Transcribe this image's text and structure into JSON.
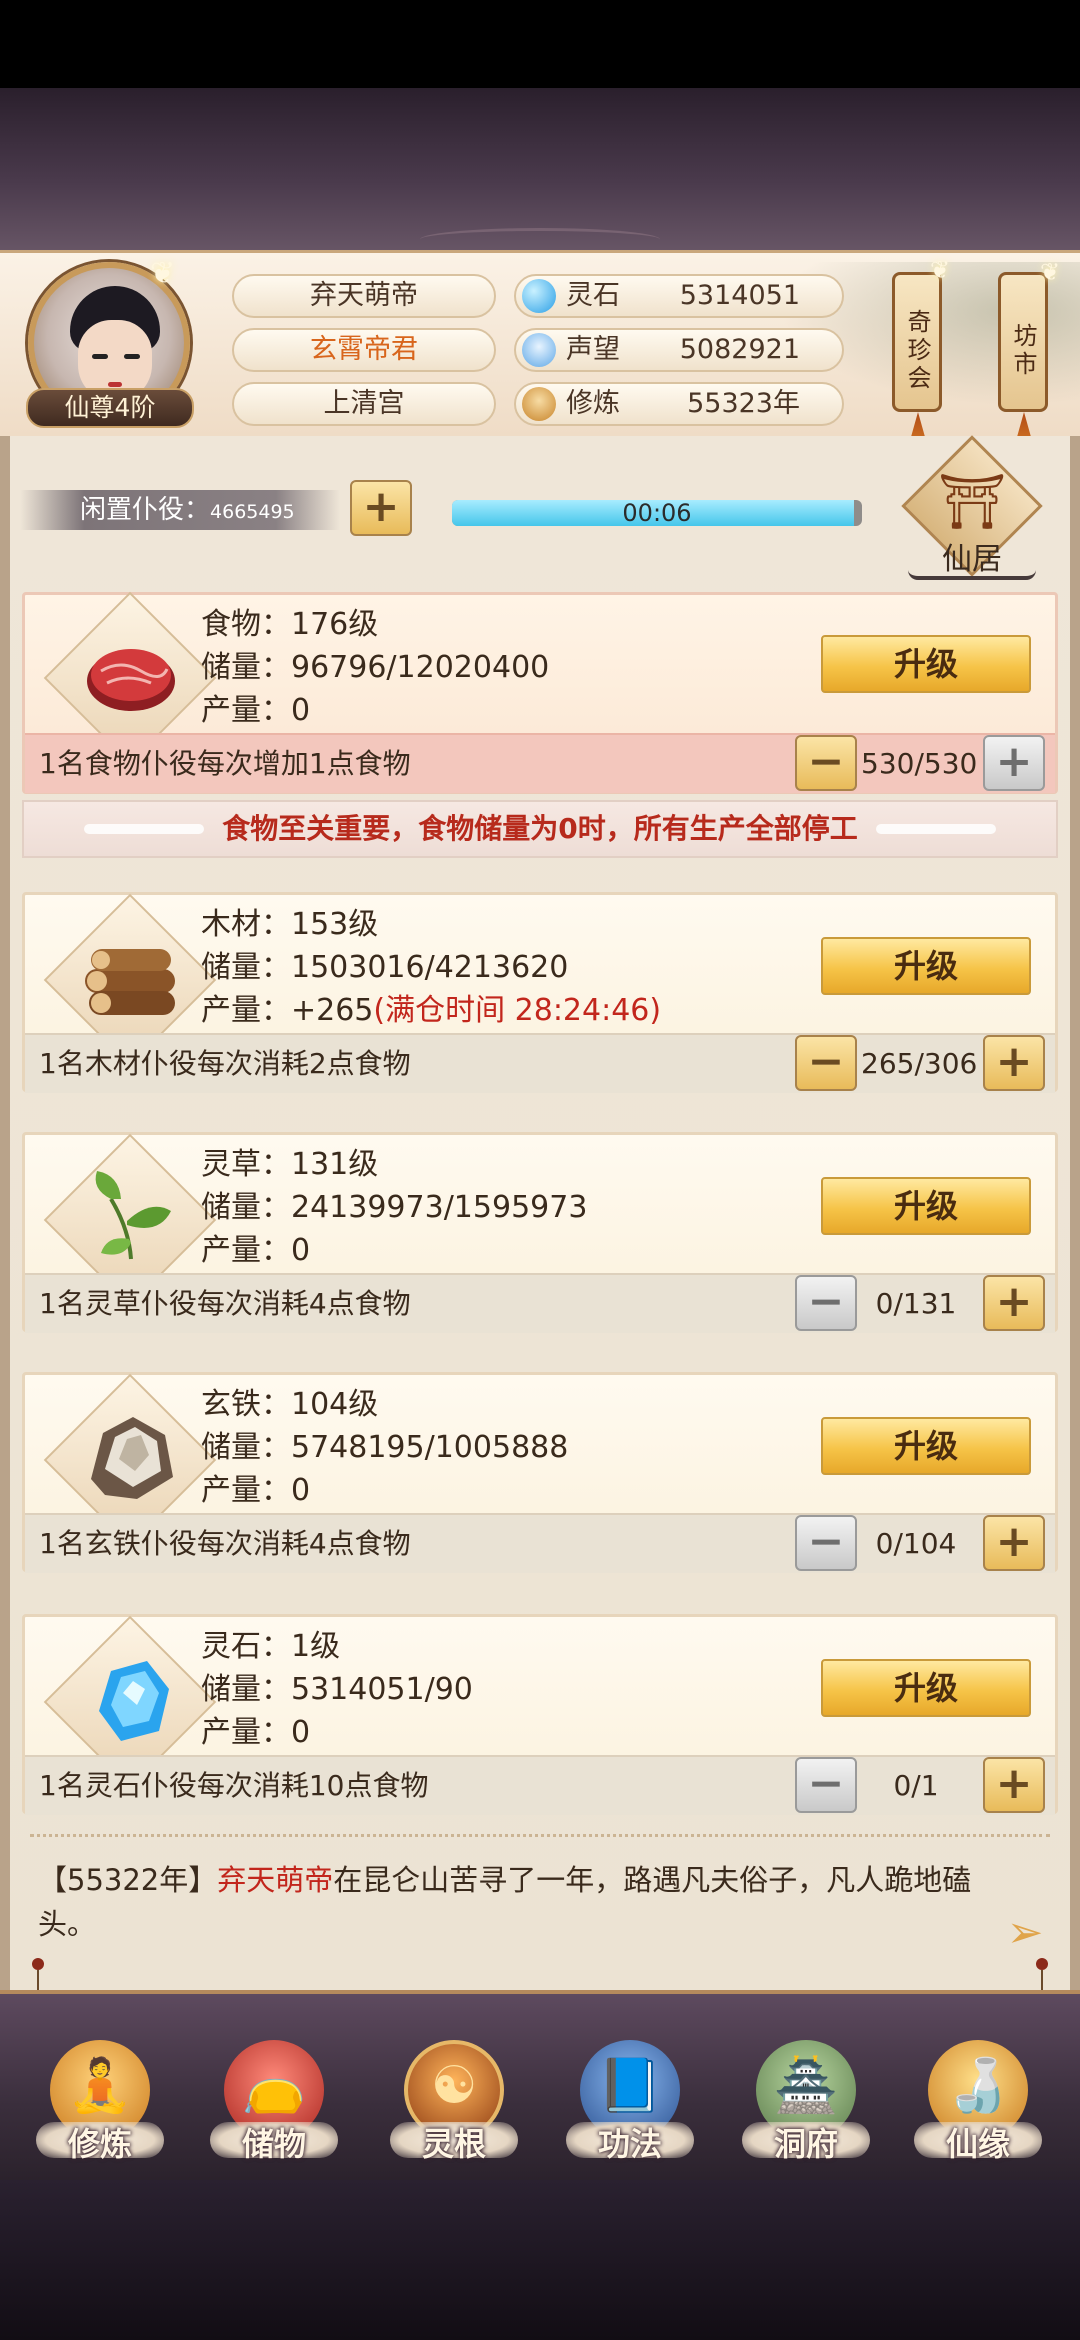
{
  "header": {
    "rank": "仙尊4阶",
    "names": [
      "弃天萌帝",
      "玄霄帝君",
      "上清宫"
    ],
    "resources": [
      {
        "icon": "spirit-stone-icon",
        "label": "灵石",
        "value": "5314051",
        "color": "#3fb6ef"
      },
      {
        "icon": "reputation-icon",
        "label": "声望",
        "value": "5082921",
        "color": "#5fa8e6"
      },
      {
        "icon": "cultivation-icon",
        "label": "修炼",
        "value": "55323年",
        "color": "#d8a24c"
      }
    ],
    "side_buttons": [
      "奇珍会",
      "坊市"
    ]
  },
  "idle": {
    "label": "闲置仆役：",
    "value": "4665495",
    "timer": "00:06",
    "timer_progress": 0.98,
    "residence_label": "仙居"
  },
  "resources": [
    {
      "id": "food",
      "icon": "meat-icon",
      "line1": "食物：176级",
      "line2": "储量：96796/12020400",
      "line3": "产量：0",
      "line3_extra": "",
      "upgrade": "升级",
      "worker_desc": "1名食物仆役每次增加1点食物",
      "worker_count": "530/530",
      "minus_active": true,
      "plus_active": false
    },
    {
      "id": "wood",
      "icon": "wood-log-icon",
      "line1": "木材：153级",
      "line2": "储量：1503016/4213620",
      "line3": "产量：+265",
      "line3_extra": "(满仓时间 28:24:46)",
      "upgrade": "升级",
      "worker_desc": "1名木材仆役每次消耗2点食物",
      "worker_count": "265/306",
      "minus_active": true,
      "plus_active": true
    },
    {
      "id": "herb",
      "icon": "herb-leaf-icon",
      "line1": "灵草：131级",
      "line2": "储量：24139973/1595973",
      "line3": "产量：0",
      "line3_extra": "",
      "upgrade": "升级",
      "worker_desc": "1名灵草仆役每次消耗4点食物",
      "worker_count": "0/131",
      "minus_active": false,
      "plus_active": true
    },
    {
      "id": "iron",
      "icon": "iron-ore-icon",
      "line1": "玄铁：104级",
      "line2": "储量：5748195/1005888",
      "line3": "产量：0",
      "line3_extra": "",
      "upgrade": "升级",
      "worker_desc": "1名玄铁仆役每次消耗4点食物",
      "worker_count": "0/104",
      "minus_active": false,
      "plus_active": true
    },
    {
      "id": "stone",
      "icon": "spirit-crystal-icon",
      "line1": "灵石：1级",
      "line2": "储量：5314051/90",
      "line3": "产量：0",
      "line3_extra": "",
      "upgrade": "升级",
      "worker_desc": "1名灵石仆役每次消耗10点食物",
      "worker_count": "0/1",
      "minus_active": false,
      "plus_active": true
    }
  ],
  "food_warning": "食物至关重要，食物储量为0时，所有生产全部停工",
  "log": {
    "prefix": "【55322年】",
    "name": "弃天萌帝",
    "text": "在昆仑山苦寻了一年，路遇凡夫俗子，凡人跪地磕头。"
  },
  "nav": [
    {
      "label": "修炼",
      "icon": "meditation-icon",
      "color": "#e39a2c"
    },
    {
      "label": "储物",
      "icon": "storage-bag-icon",
      "color": "#c93a36"
    },
    {
      "label": "灵根",
      "icon": "spirit-root-icon",
      "color": "#e07a1c"
    },
    {
      "label": "功法",
      "icon": "technique-book-icon",
      "color": "#3c6fb4"
    },
    {
      "label": "洞府",
      "icon": "cave-residence-icon",
      "color": "#7a9c6a"
    },
    {
      "label": "仙缘",
      "icon": "gourd-icon",
      "color": "#e8a030"
    }
  ]
}
